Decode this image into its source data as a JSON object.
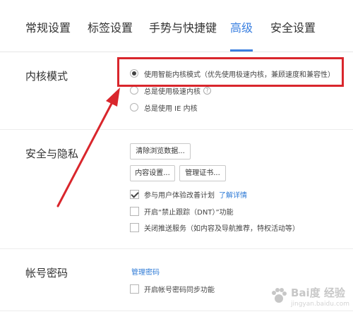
{
  "tabs": {
    "general": "常规设置",
    "tab_settings": "标签设置",
    "gestures": "手势与快捷键",
    "advanced": "高级",
    "security": "安全设置"
  },
  "kernel": {
    "label": "内核模式",
    "option_smart": "使用智能内核模式（优先使用极速内核，兼顾速度和兼容性）",
    "option_speed": "总是使用极速内核",
    "option_ie": "总是使用 IE 内核",
    "selected": "option_smart"
  },
  "privacy": {
    "label": "安全与隐私",
    "clear_button": "清除浏览数据...",
    "content_button": "内容设置...",
    "cert_button": "管理证书...",
    "ux_plan": "参与用户体验改善计划",
    "ux_plan_checked": true,
    "learn_more": "了解详情",
    "dnt": "开启“禁止跟踪（DNT）”功能",
    "dnt_checked": false,
    "push": "关闭推送服务（如内容及导航推荐，特权活动等）",
    "push_checked": false
  },
  "account": {
    "label": "帐号密码",
    "manage_password": "管理密码",
    "sync": "开启帐号密码同步功能",
    "sync_checked": false
  },
  "watermark": {
    "brand": "Bai度 经验",
    "url": "jingyan.baidu.com"
  },
  "colors": {
    "accent": "#3a7fe0",
    "annotation": "#d9262c",
    "link": "#2d7ad6"
  }
}
